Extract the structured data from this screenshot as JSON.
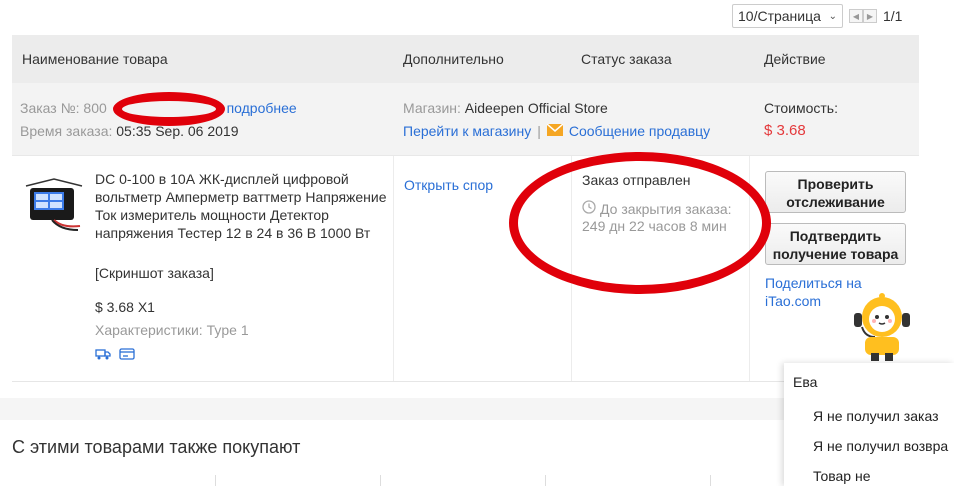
{
  "pagination": {
    "per_page": "10/Страница",
    "page_count": "1/1"
  },
  "table_header": {
    "product": "Наименование товара",
    "extra": "Дополнительно",
    "status": "Статус заказа",
    "action": "Действие"
  },
  "order": {
    "number_label": "Заказ №:",
    "number_prefix": "800",
    "details_link": "подробнее",
    "time_label": "Время заказа:",
    "time_value": "05:35 Sep. 06 2019",
    "store_label": "Магазин:",
    "store_name": "Aideepen Official Store",
    "go_store_link": "Перейти к магазину",
    "separator": "|",
    "message_seller_link": "Сообщение продавцу",
    "cost_label": "Стоимость:",
    "cost_value": "$ 3.68"
  },
  "item": {
    "title": "DC 0-100 в 10А ЖК-дисплей цифровой вольтметр Амперметр ваттметр Напряжение Ток измеритель мощности Детектор напряжения Тестер 12 в 24 в 36 В 1000 Вт",
    "snapshot": "[Скриншот заказа]",
    "price_qty": "$ 3.68 X1",
    "characteristics": "Характеристики: Type 1",
    "dispute_link": "Открыть спор",
    "status": "Заказ отправлен",
    "countdown_label": "До закрытия заказа:",
    "countdown_value": "249 дн 22 часов 8 мин",
    "track_button": "Проверить отслеживание",
    "confirm_button": "Подтвердить получение товара",
    "share_text": "Поделиться на",
    "share_site": "iTao.com"
  },
  "also_bought_title": "С этими товарами также покупают",
  "chat": {
    "name": "Ева",
    "options": [
      "Я не получил заказ",
      "Я не получил возвра",
      "Товар не"
    ]
  },
  "colors": {
    "link": "#2a6fd6",
    "price": "#e4393c",
    "annotation": "#e0000a",
    "header_bg": "#ececec"
  }
}
